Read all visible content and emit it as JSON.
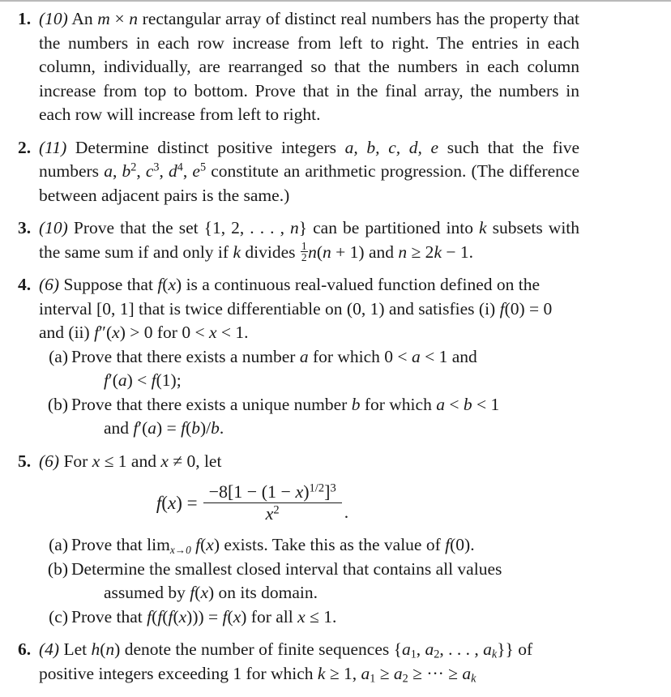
{
  "document": {
    "type": "mathematics-problem-set",
    "problems": [
      {
        "number": "1.",
        "points": "(10)",
        "body": "An m × n rectangular array of distinct real numbers has the property that the numbers in each row increase from left to right. The entries in each column, individually, are rearranged so that the numbers in each column increase from top to bottom. Prove that in the final array, the numbers in each row will increase from left to right."
      },
      {
        "number": "2.",
        "points": "(11)",
        "body": "Determine distinct positive integers a, b, c, d, e such that the five numbers a, b², c³, d⁴, e⁵ constitute an arithmetic progression. (The difference between adjacent pairs is the same.)"
      },
      {
        "number": "3.",
        "points": "(10)",
        "body": "Prove that the set {1, 2, …, n} can be partitioned into k subsets with the same sum if and only if k divides ½n(n + 1) and n ≥ 2k − 1."
      },
      {
        "number": "4.",
        "points": "(6)",
        "body": "Suppose that f(x) is a continuous real-valued function defined on the interval [0, 1] that is twice differentiable on (0, 1) and satisfies (i) f(0) = 0 and (ii) f″(x) > 0 for 0 < x < 1.",
        "subparts": [
          {
            "label": "(a)",
            "text": "Prove that there exists a number a for which 0 < a < 1 and f′(a) < f(1);"
          },
          {
            "label": "(b)",
            "text": "Prove that there exists a unique number b for which a < b < 1 and f′(a) = f(b)/b."
          }
        ]
      },
      {
        "number": "5.",
        "points": "(6)",
        "body": "For x ≤ 1 and x ≠ 0, let",
        "equation": {
          "lhs": "f(x) =",
          "numerator": "−8[1 − (1 − x)^(1/2)]³",
          "denominator": "x²",
          "trailing": "."
        },
        "subparts": [
          {
            "label": "(a)",
            "text": "Prove that lim_{x→0} f(x) exists. Take this as the value of f(0)."
          },
          {
            "label": "(b)",
            "text": "Determine the smallest closed interval that contains all values assumed by f(x) on its domain."
          },
          {
            "label": "(c)",
            "text": "Prove that f(f(f(x))) = f(x) for all x ≤ 1."
          }
        ]
      },
      {
        "number": "6.",
        "points": "(4)",
        "body": "Let h(n) denote the number of finite sequences {a₁, a₂, …, a_k} of positive integers exceeding 1 for which k ≥ 1, a₁ ≥ a₂ ≥ ⋯ ≥ a_k",
        "truncated": true
      }
    ],
    "fragments": {
      "p1_line1a": "An ",
      "p1_m": "m",
      "p1_times": " × ",
      "p1_n": "n",
      "p1_rest": " rectangular array of distinct real numbers has the property that the numbers in each row increase from left to right. The entries in each column, individually, are rearranged so that the numbers in each column increase from top to bottom. Prove that in the final array, the numbers in each row will increase from left to right.",
      "p2_a": "Determine distinct positive integers ",
      "p2_vars": "a, b, c, d, e",
      "p2_b": " such that the five numbers ",
      "p2_c": " constitute an arithmetic progression. (The difference between adjacent pairs is the same.)",
      "p3_a": "Prove that the set {1, 2, . . . , ",
      "p3_n": "n",
      "p3_b": "} can be partitioned into ",
      "p3_k": "k",
      "p3_c": " subsets with the same sum if and only if ",
      "p3_k2": "k",
      "p3_d": " divides ",
      "p3_fnum": "1",
      "p3_fden": "2",
      "p3_e": "(",
      "p3_f": " + 1) and ",
      "p3_g": " ≥ 2",
      "p3_h": " − 1.",
      "p4_a": "Suppose that ",
      "p4_b": " is a continuous real-valued function defined on the interval [0, 1] that is twice differentiable on (0, 1) and satisfies (i) ",
      "p4_c": "(0) = 0 and (ii) ",
      "p4_d": "″(",
      "p4_e": ") > 0 for 0 < ",
      "p4_f": " < 1.",
      "p4a_1": "Prove that there exists a number ",
      "p4a_2": " for which 0 < ",
      "p4a_3": " < 1 and",
      "p4a_cont_a": "′(",
      "p4a_cont_b": ") < ",
      "p4a_cont_c": "(1);",
      "p4b_1": "Prove that there exists a unique number ",
      "p4b_2": " for which ",
      "p4b_3": " < ",
      "p4b_4": " < 1",
      "p4b_cont": "and ",
      "p5_a": "For ",
      "p5_b": " ≤ 1 and ",
      "p5_c": " ≠ 0, let",
      "p5a_1": "Prove that lim",
      "p5a_sub": "x→0",
      "p5a_2": " exists. Take this as the value of ",
      "p5a_3": "(0).",
      "p5b_1": "Determine the smallest closed interval that contains all values",
      "p5b_2": "assumed by ",
      "p5b_3": " on its domain.",
      "p5c_1": "Prove that ",
      "p5c_2": " for all ",
      "p5c_3": " ≤ 1.",
      "p6_a": "Let ",
      "p6_h": "h",
      "p6_b": "(",
      "p6_n": "n",
      "p6_c": ") denote the number of finite sequences {",
      "p6_d": "} of positive integers exceeding 1 for which ",
      "p6_k": "k",
      "p6_e": " ≥ 1, "
    }
  }
}
